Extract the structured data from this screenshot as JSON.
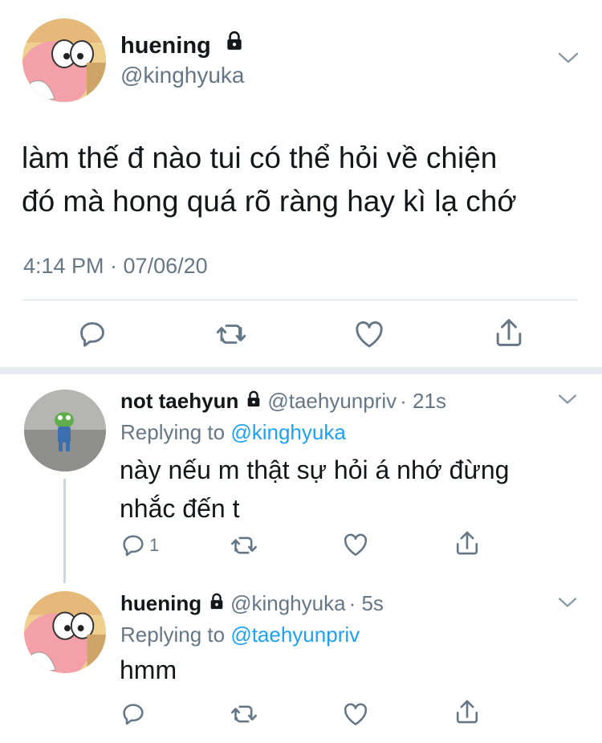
{
  "main_tweet": {
    "display_name": "huening",
    "handle": "@kinghyuka",
    "text_line1": "làm thế đ nào tui có thể hỏi về chiện",
    "text_line2": "đó mà hong quá rõ ràng hay kì lạ chớ",
    "timestamp": "4:14 PM · 07/06/20"
  },
  "replies": [
    {
      "display_name": "not taehyun",
      "handle": "@taehyunpriv",
      "time": "· 21s",
      "replying_prefix": "Replying to",
      "replying_to": "@kinghyuka",
      "text_line1": "này nếu m thật sự hỏi á nhớ đừng",
      "text_line2": "nhắc đến t",
      "reply_count": "1"
    },
    {
      "display_name": "huening",
      "handle": "@kinghyuka",
      "time": "· 5s",
      "replying_prefix": "Replying to",
      "replying_to": "@taehyunpriv",
      "text_line1": "hmm"
    }
  ],
  "icons": {
    "reply": "reply-icon",
    "retweet": "retweet-icon",
    "like": "heart-icon",
    "share": "share-icon",
    "lock": "lock-icon",
    "more": "chevron-down-icon"
  },
  "colors": {
    "text": "#14171a",
    "muted": "#657786",
    "link": "#1da1f2",
    "divider": "#e6ecf0"
  }
}
